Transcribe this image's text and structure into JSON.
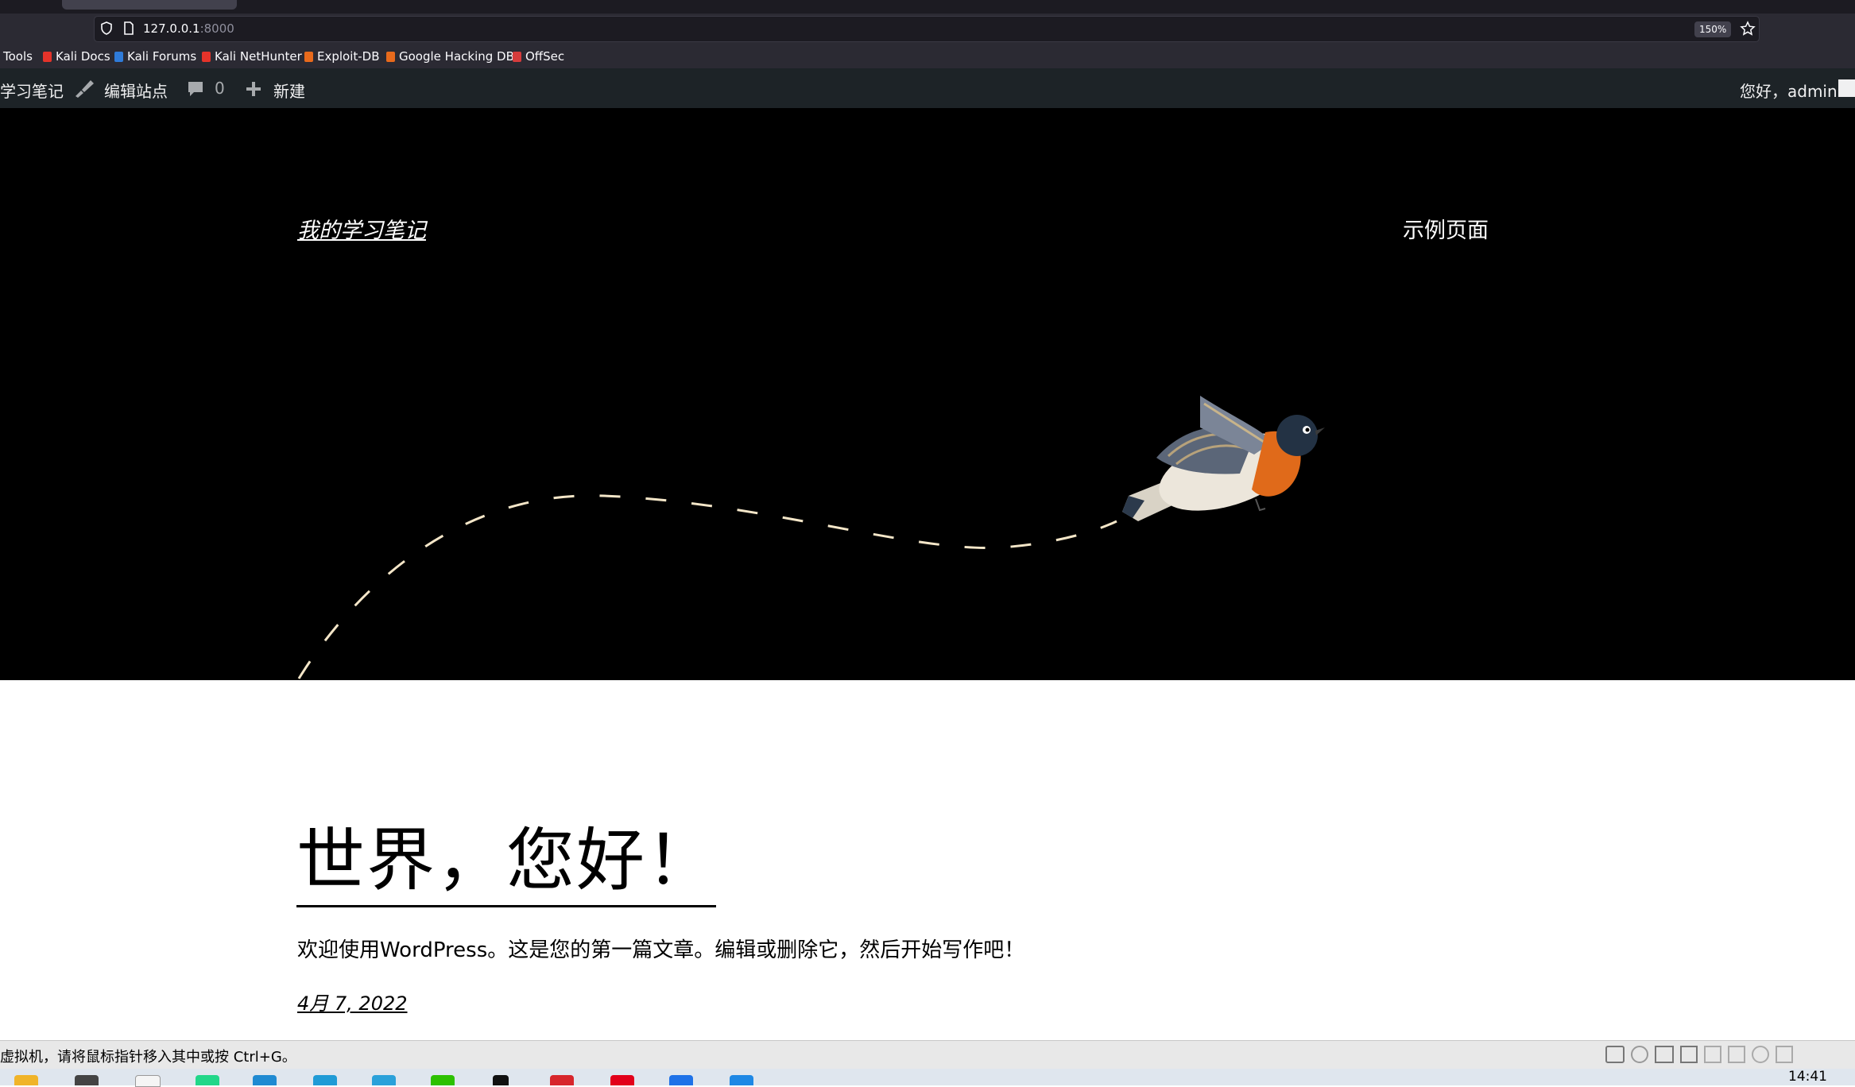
{
  "browser": {
    "url_host": "127.0.0.1",
    "url_port": ":8000",
    "zoom": "150%",
    "bookmarks": [
      {
        "label": "Tools",
        "icon": "none"
      },
      {
        "label": "Kali Docs",
        "icon": "kali-docs-icon",
        "color": "#e5332a"
      },
      {
        "label": "Kali Forums",
        "icon": "kali-forums-icon",
        "color": "#2f7bd9"
      },
      {
        "label": "Kali NetHunter",
        "icon": "nethunter-icon",
        "color": "#e5332a"
      },
      {
        "label": "Exploit-DB",
        "icon": "exploit-db-icon",
        "color": "#e86a1c"
      },
      {
        "label": "Google Hacking DB",
        "icon": "ghdb-icon",
        "color": "#e86a1c"
      },
      {
        "label": "OffSec",
        "icon": "offsec-icon",
        "color": "#d63c3c"
      }
    ]
  },
  "adminbar": {
    "site_name": "学习笔记",
    "edit_site": "编辑站点",
    "comments_count": "0",
    "new_label": "新建",
    "greeting": "您好，admin"
  },
  "header": {
    "site_title": "我的学习笔记",
    "nav_item": "示例页面"
  },
  "post": {
    "title": "世界，您好！",
    "body": "欢迎使用WordPress。这是您的第一篇文章。编辑或删除它，然后开始写作吧！",
    "date": "4月 7, 2022"
  },
  "vm": {
    "status_text": "虚拟机，请将鼠标指针移入其中或按 Ctrl+G。"
  },
  "taskbar": {
    "clock": "14:41",
    "apps": [
      {
        "name": "file-explorer-icon",
        "color": "#f0b429"
      },
      {
        "name": "settings-icon",
        "color": "#444"
      },
      {
        "name": "calendar-icon",
        "color": "#e8e8e8"
      },
      {
        "name": "pycharm-icon",
        "color": "#21d789"
      },
      {
        "name": "vscode-icon",
        "color": "#1f8ad2"
      },
      {
        "name": "edge-icon",
        "color": "#1f9bd6"
      },
      {
        "name": "telegram-icon",
        "color": "#2aa1da"
      },
      {
        "name": "wechat-icon",
        "color": "#2dc100"
      },
      {
        "name": "qq-icon",
        "color": "#111"
      },
      {
        "name": "wps-icon",
        "color": "#d7262c"
      },
      {
        "name": "netease-icon",
        "color": "#e2001a"
      },
      {
        "name": "mail-icon",
        "color": "#1e72e8"
      },
      {
        "name": "vmware-icon",
        "color": "#1e88e5"
      }
    ]
  },
  "colors": {
    "admin_bar": "#1d2327",
    "hero_bg": "#000000",
    "browser_chrome": "#2b2a33"
  }
}
